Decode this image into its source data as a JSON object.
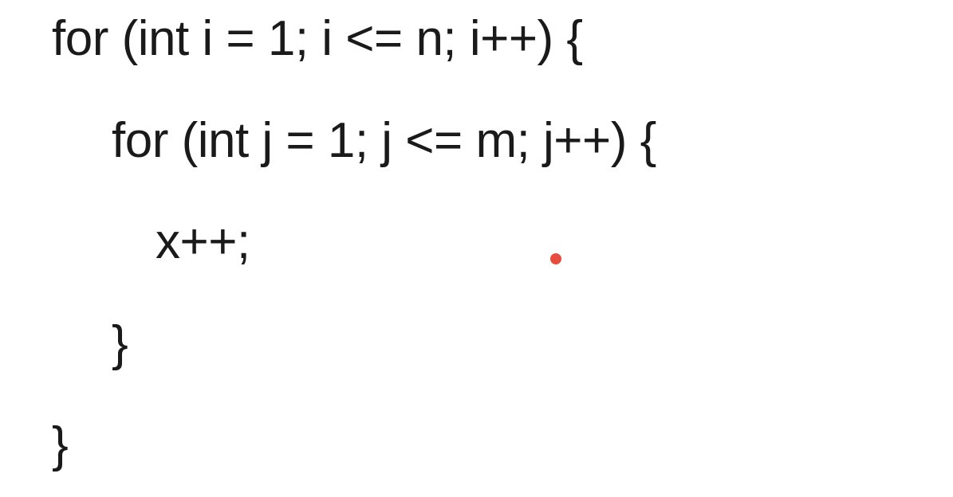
{
  "code": {
    "line1": "for (int i = 1; i <= n; i++) {",
    "line2": "for (int j = 1; j <= m; j++) {",
    "line3": "x++;",
    "line4": "}",
    "line5": "}"
  },
  "pointer": {
    "color": "#e74c3c"
  }
}
